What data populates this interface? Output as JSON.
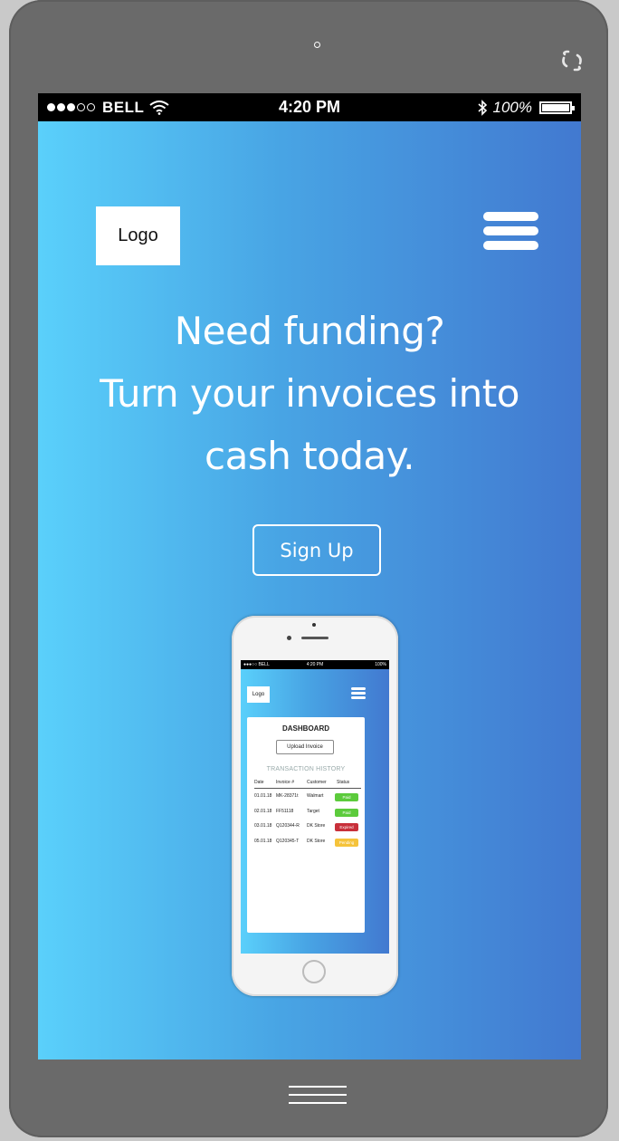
{
  "status_bar": {
    "carrier": "BELL",
    "time": "4:20 PM",
    "battery": "100%"
  },
  "header": {
    "logo_label": "Logo"
  },
  "hero": {
    "headline_line1": "Need funding?",
    "headline_line2": "Turn your invoices into",
    "headline_line3": "cash today.",
    "signup_label": "Sign Up"
  },
  "preview": {
    "status_bar": {
      "carrier": "BELL",
      "time": "4:20 PM",
      "battery": "100%"
    },
    "logo_label": "Logo",
    "dashboard_title": "DASHBOARD",
    "upload_label": "Upload Invoice",
    "history_title": "TRANSACTION HISTORY",
    "columns": [
      "Date",
      "Invoice #",
      "Customer",
      "Status"
    ],
    "rows": [
      {
        "date": "01.01.18",
        "invoice": "MK-28371t",
        "customer": "Walmart",
        "status": "Paid",
        "status_color": "#5ccb3c"
      },
      {
        "date": "02.01.18",
        "invoice": "FF51118",
        "customer": "Target",
        "status": "Paid",
        "status_color": "#5ccb3c"
      },
      {
        "date": "03.01.18",
        "invoice": "Q120344-R",
        "customer": "DK Store",
        "status": "Expired",
        "status_color": "#c8303a"
      },
      {
        "date": "05.01.18",
        "invoice": "Q120345-T",
        "customer": "DK Store",
        "status": "Pending",
        "status_color": "#f5c33b"
      }
    ]
  },
  "colors": {
    "gradient_start": "#5ad0fb",
    "gradient_end": "#4279d0",
    "device_frame": "#6a6a6a"
  },
  "icons": [
    "rotate-icon",
    "wifi-icon",
    "bluetooth-icon",
    "battery-icon",
    "hamburger-menu-icon",
    "home-indicator-icon"
  ]
}
